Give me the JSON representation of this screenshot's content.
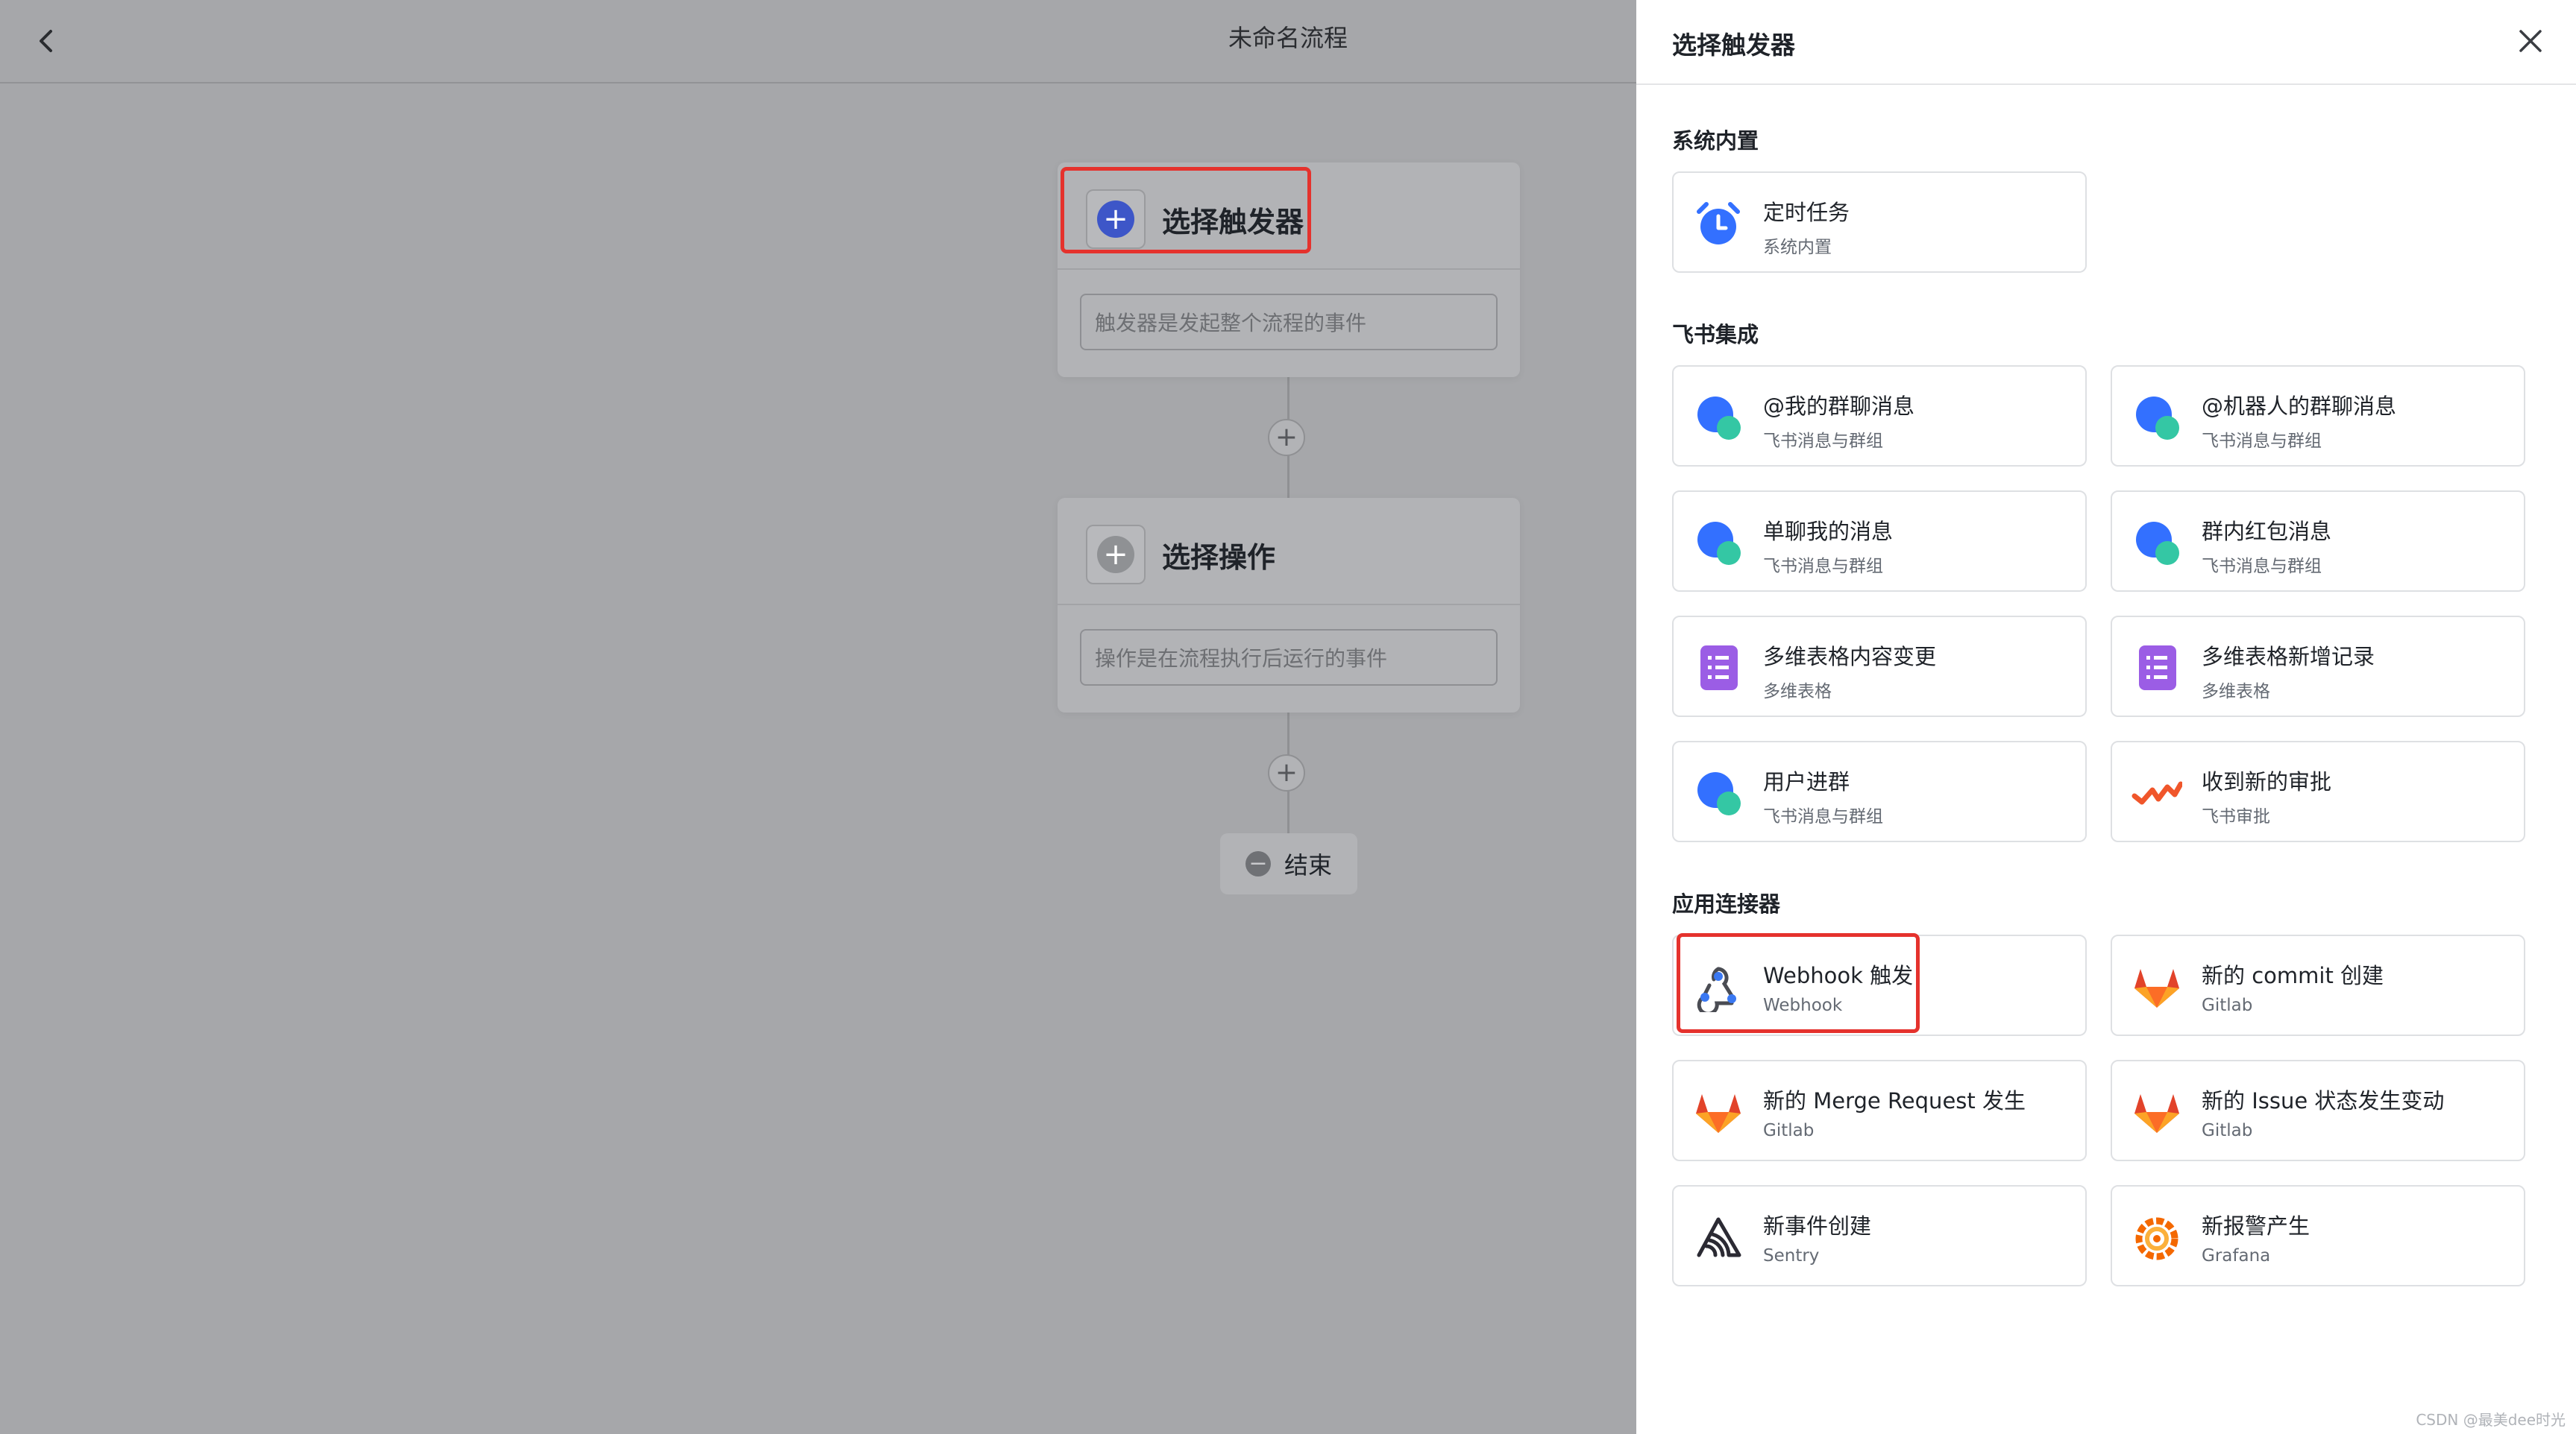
{
  "editor": {
    "title": "未命名流程",
    "trigger_node": {
      "label": "选择触发器",
      "placeholder": "触发器是发起整个流程的事件",
      "accent": "#3d56c8"
    },
    "action_node": {
      "label": "选择操作",
      "placeholder": "操作是在流程执行后运行的事件",
      "accent": "#8f9194"
    },
    "add_icon": "+",
    "end_node": {
      "icon": "−",
      "label": "结束"
    }
  },
  "drawer": {
    "title": "选择触发器",
    "close_icon": "close-icon",
    "sections": [
      {
        "title": "系统内置",
        "cards": [
          {
            "name": "定时任务",
            "sub": "系统内置",
            "icon": "alarm-clock-icon"
          }
        ]
      },
      {
        "title": "飞书集成",
        "cards": [
          {
            "name": "@我的群聊消息",
            "sub": "飞书消息与群组",
            "icon": "chat-bubble-icon"
          },
          {
            "name": "@机器人的群聊消息",
            "sub": "飞书消息与群组",
            "icon": "chat-bubble-icon"
          },
          {
            "name": "单聊我的消息",
            "sub": "飞书消息与群组",
            "icon": "chat-bubble-icon"
          },
          {
            "name": "群内红包消息",
            "sub": "飞书消息与群组",
            "icon": "chat-bubble-icon"
          },
          {
            "name": "多维表格内容变更",
            "sub": "多维表格",
            "icon": "bitable-icon"
          },
          {
            "name": "多维表格新增记录",
            "sub": "多维表格",
            "icon": "bitable-icon"
          },
          {
            "name": "用户进群",
            "sub": "飞书消息与群组",
            "icon": "chat-bubble-icon"
          },
          {
            "name": "收到新的审批",
            "sub": "飞书审批",
            "icon": "approval-icon"
          }
        ]
      },
      {
        "title": "应用连接器",
        "cards": [
          {
            "name": "Webhook 触发",
            "sub": "Webhook",
            "icon": "webhook-icon"
          },
          {
            "name": "新的 commit 创建",
            "sub": "Gitlab",
            "icon": "gitlab-icon"
          },
          {
            "name": "新的 Merge Request 发生",
            "sub": "Gitlab",
            "icon": "gitlab-icon"
          },
          {
            "name": "新的 Issue 状态发生变动",
            "sub": "Gitlab",
            "icon": "gitlab-icon"
          },
          {
            "name": "新事件创建",
            "sub": "Sentry",
            "icon": "sentry-icon"
          },
          {
            "name": "新报警产生",
            "sub": "Grafana",
            "icon": "grafana-icon"
          }
        ]
      }
    ]
  },
  "colors": {
    "highlight": "#e5322d",
    "feishu_blue": "#3370ff",
    "feishu_teal": "#34c7a4",
    "bitable_purple": "#9b5de5",
    "gitlab_orange": "#e2432a"
  },
  "watermark": "CSDN @最美dee时光"
}
